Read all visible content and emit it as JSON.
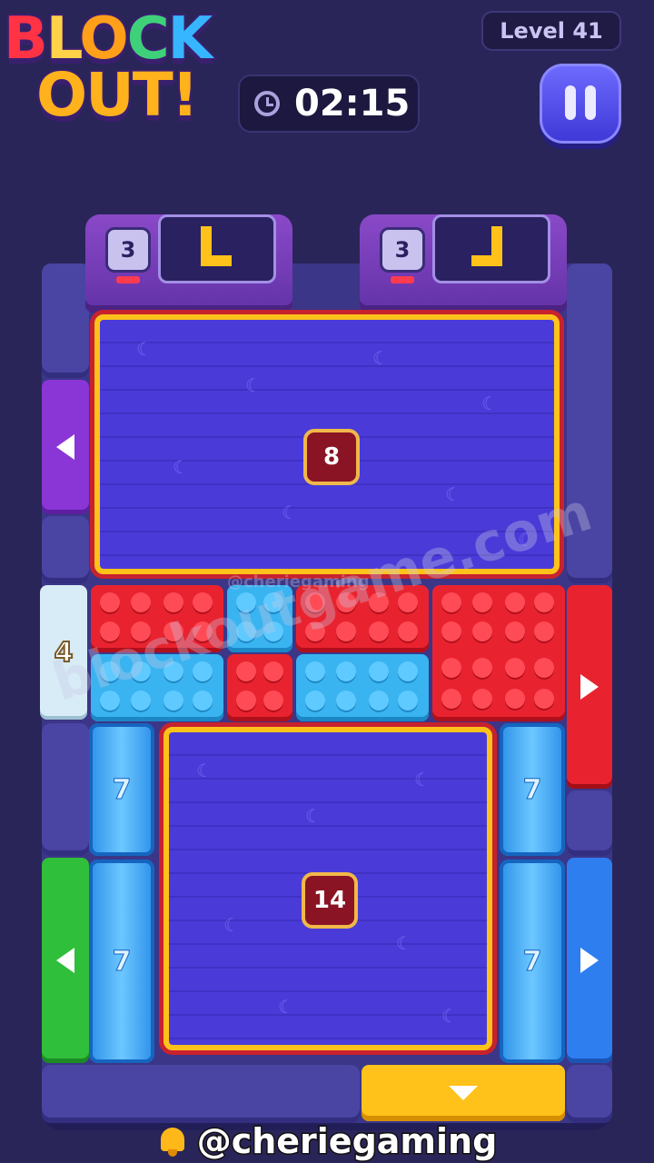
{
  "logo": {
    "line1": [
      "B",
      "L",
      "O",
      "C",
      "K"
    ],
    "line2": "OUT!"
  },
  "header": {
    "level_label": "Level 41",
    "timer": "02:15"
  },
  "spawners": [
    {
      "count": "3"
    },
    {
      "count": "3"
    }
  ],
  "wood_areas": [
    {
      "count": "8"
    },
    {
      "count": "14"
    }
  ],
  "ice_blocks": [
    {
      "count": "7"
    },
    {
      "count": "7"
    },
    {
      "count": "7"
    },
    {
      "count": "7"
    }
  ],
  "white_exit": {
    "count": "4"
  },
  "watermarks": {
    "blockout": "blockoutgame.com",
    "cherie": "@cheriegaming"
  },
  "footer": {
    "handle": "@cheriegaming"
  },
  "colors": {
    "red": "#e8232f",
    "blue": "#39b4f0",
    "yellow": "#ffc21a",
    "purple": "#8a35d6",
    "green": "#2fbf3a"
  }
}
